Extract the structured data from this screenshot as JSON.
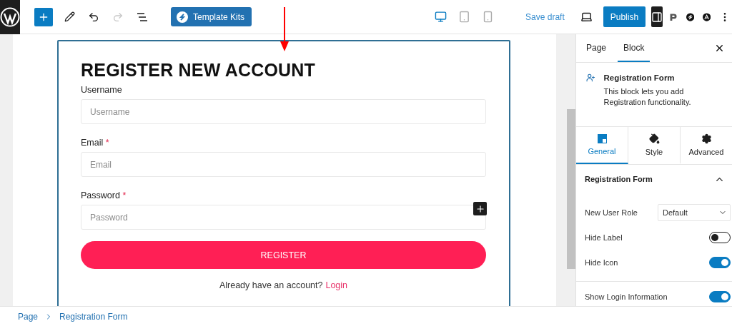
{
  "toolbar": {
    "template_kits": "Template Kits",
    "devices": [
      {
        "kind": "desktop",
        "selected": true
      },
      {
        "kind": "tablet",
        "selected": false
      },
      {
        "kind": "mobile",
        "selected": false
      }
    ],
    "save_draft": "Save draft",
    "publish": "Publish",
    "settings_open": true
  },
  "form": {
    "title": "REGISTER NEW ACCOUNT",
    "fields": [
      {
        "label": "Username",
        "required": false,
        "placeholder": "Username"
      },
      {
        "label": "Email",
        "required": true,
        "placeholder": "Email"
      },
      {
        "label": "Password",
        "required": true,
        "placeholder": "Password"
      }
    ],
    "required_mark": "*",
    "submit": "REGISTER",
    "footer_text": "Already have an account?",
    "login_link": "Login"
  },
  "sidebar": {
    "tabs": [
      {
        "label": "Page",
        "selected": false
      },
      {
        "label": "Block",
        "selected": true
      }
    ],
    "block": {
      "title": "Registration Form",
      "description": "This block lets you add Registration functionality."
    },
    "subtabs": [
      {
        "kind": "general",
        "label": "General",
        "selected": true
      },
      {
        "kind": "style",
        "label": "Style",
        "selected": false
      },
      {
        "kind": "advanced",
        "label": "Advanced",
        "selected": false
      }
    ],
    "panel": {
      "title": "Registration Form",
      "expanded": true
    },
    "settings": [
      {
        "kind": "select",
        "label": "New User Role",
        "value": "Default"
      },
      {
        "kind": "toggle",
        "label": "Hide Label",
        "on": false
      },
      {
        "kind": "toggle",
        "label": "Hide Icon",
        "on": true
      },
      {
        "kind": "toggle",
        "label": "Show Login Information",
        "on": true,
        "divider_before": true
      }
    ]
  },
  "breadcrumb": [
    "Page",
    "Registration Form"
  ]
}
